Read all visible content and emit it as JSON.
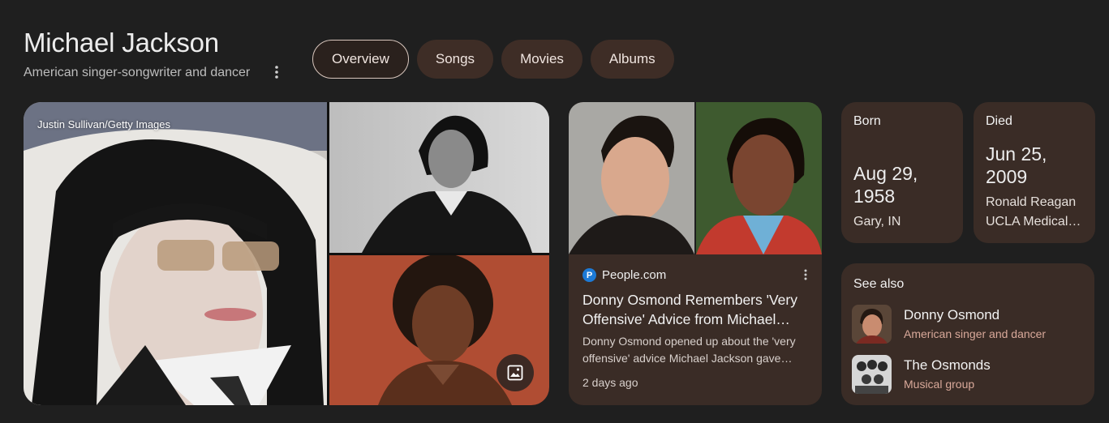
{
  "entity": {
    "title": "Michael Jackson",
    "subtitle": "American singer-songwriter and dancer"
  },
  "tabs": [
    {
      "label": "Overview",
      "active": true
    },
    {
      "label": "Songs",
      "active": false
    },
    {
      "label": "Movies",
      "active": false
    },
    {
      "label": "Albums",
      "active": false
    }
  ],
  "images": {
    "credit": "Justin Sullivan/Getty Images"
  },
  "news": {
    "source": "People.com",
    "source_logo_letter": "P",
    "title": "Donny Osmond Remembers 'Very Offensive' Advice from Michael…",
    "snippet": "Donny Osmond opened up about the 'very offensive' advice Michael Jackson gave…",
    "time": "2 days ago"
  },
  "facts": {
    "born": {
      "label": "Born",
      "date_line1": "Aug 29,",
      "date_line2": "1958",
      "place_line1": "Gary, IN",
      "place_line2": ""
    },
    "died": {
      "label": "Died",
      "date_line1": "Jun 25,",
      "date_line2": "2009",
      "place_line1": "Ronald Reagan",
      "place_line2": "UCLA Medical…"
    }
  },
  "see_also": {
    "title": "See also",
    "items": [
      {
        "name": "Donny Osmond",
        "desc": "American singer and dancer"
      },
      {
        "name": "The Osmonds",
        "desc": "Musical group"
      }
    ]
  },
  "colors": {
    "background": "#1f1f1f",
    "card": "#3a2c26",
    "chip": "#3e2d26",
    "accent_text": "#d9a99a"
  }
}
